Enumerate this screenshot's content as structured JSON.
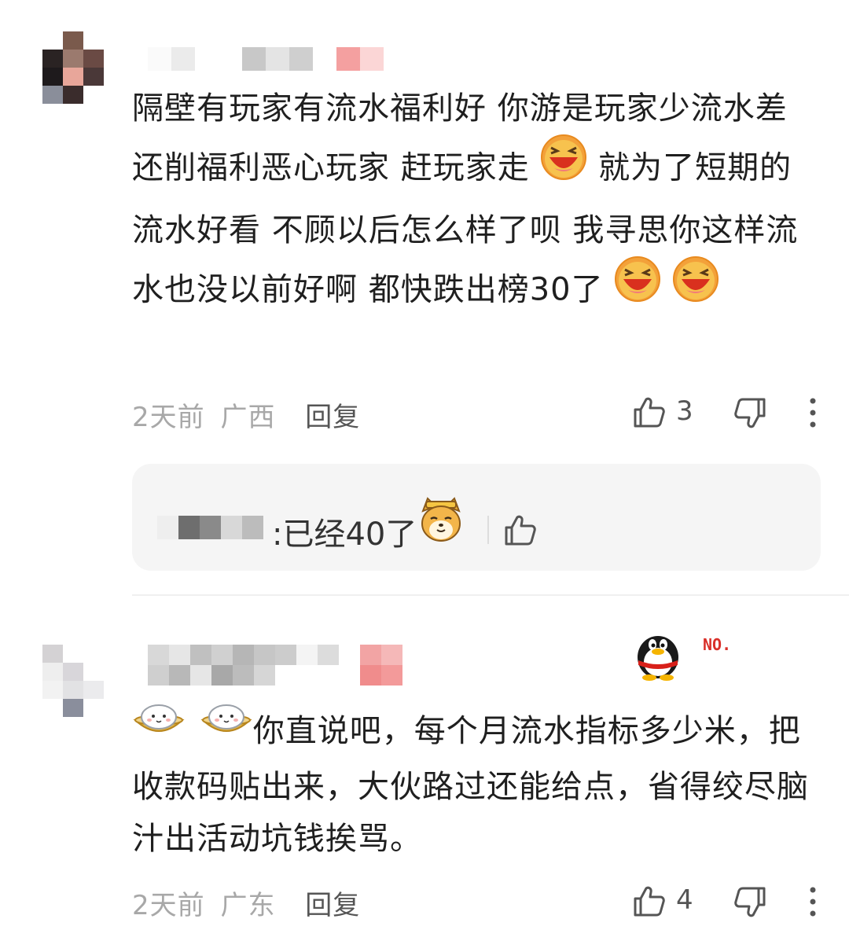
{
  "comments": [
    {
      "text_parts": [
        "隔壁有玩家有流水福利好 你游是玩家少流水差 还削福利恶心玩家 赶玩家走",
        "就为了短期的流水好看 不顾以后怎么样了呗 我寻思你这样流水也没以前好啊 都快跌出榜30了"
      ],
      "time": "2天前",
      "location": "广西",
      "reply_label": "回复",
      "likes": "3",
      "reply_preview": {
        "text": ":已经40了"
      }
    },
    {
      "badge": "NO.",
      "text": "你直说吧，每个月流水指标多少米，把收款码贴出来，大伙路过还能给点，省得绞尽脑汁出活动坑钱挨骂。",
      "time": "2天前",
      "location": "广东",
      "reply_label": "回复",
      "likes": "4"
    }
  ],
  "colors": {
    "meta_gray": "#a8a8a8",
    "text": "#1f1f1f",
    "reply_bg": "#f5f5f5",
    "laugh_emoji": "#e8452c"
  }
}
